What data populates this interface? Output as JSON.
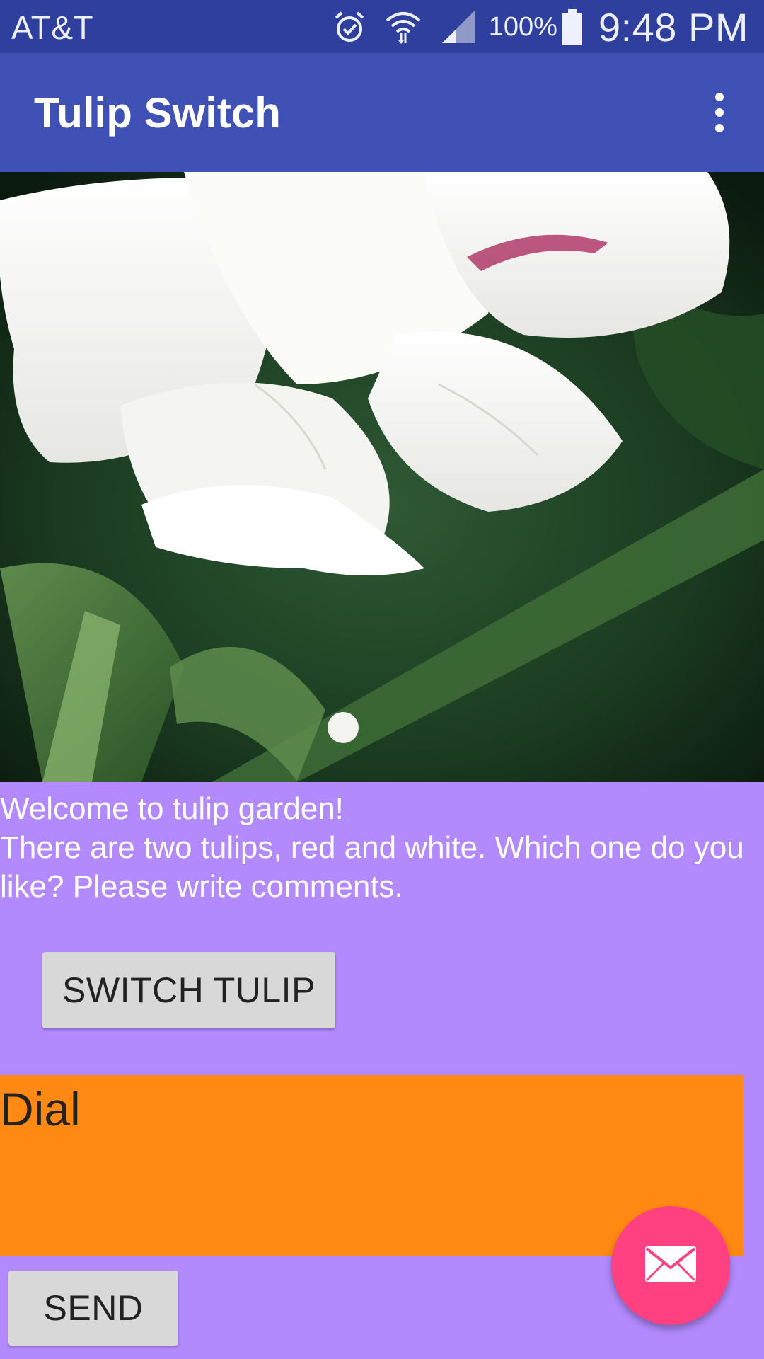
{
  "status_bar": {
    "carrier": "AT&T",
    "icons": [
      "alarm-icon",
      "wifi-icon",
      "signal-icon",
      "battery-icon"
    ],
    "battery": "100%",
    "time": "9:48 PM"
  },
  "app_bar": {
    "title": "Tulip Switch",
    "menu_icon": "overflow-menu-icon"
  },
  "hero_image": {
    "subject": "white-tulip-photo"
  },
  "content": {
    "welcome_line1": "Welcome to tulip garden!",
    "welcome_line2": "There are two tulips, red and white. Which one do you like? Please write comments.",
    "switch_button_label": "SWITCH TULIP",
    "dial_text": "Dial",
    "send_button_label": "SEND"
  },
  "fab": {
    "icon": "mail-icon"
  },
  "colors": {
    "status_bar": "#2f3f9e",
    "app_bar": "#3f51b5",
    "background": "#b28afe",
    "dial_box": "#ff8912",
    "fab": "#ff4081",
    "button": "#d8d8d8"
  }
}
